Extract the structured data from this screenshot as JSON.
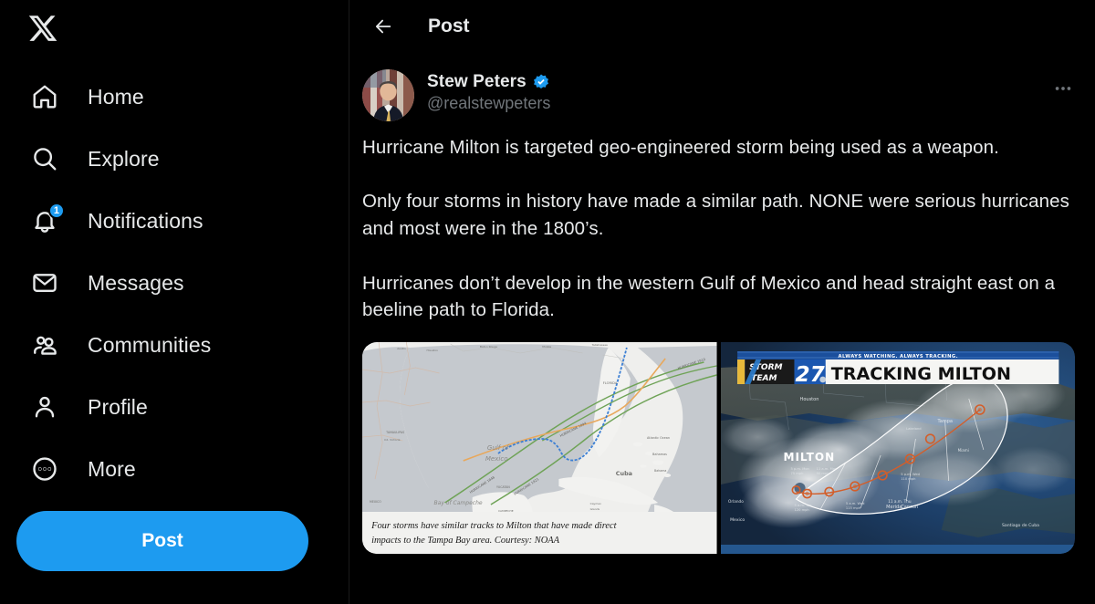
{
  "app": {
    "name": "X",
    "logo_icon": "x-logo-icon"
  },
  "sidebar": {
    "items": [
      {
        "label": "Home",
        "icon": "home-icon",
        "badge": null
      },
      {
        "label": "Explore",
        "icon": "search-icon",
        "badge": null
      },
      {
        "label": "Notifications",
        "icon": "bell-icon",
        "badge": "1"
      },
      {
        "label": "Messages",
        "icon": "envelope-icon",
        "badge": null
      },
      {
        "label": "Communities",
        "icon": "people-icon",
        "badge": null
      },
      {
        "label": "Profile",
        "icon": "person-icon",
        "badge": null
      },
      {
        "label": "More",
        "icon": "more-circle-icon",
        "badge": null
      }
    ],
    "post_button": {
      "label": "Post",
      "color": "#1d9bf0"
    }
  },
  "header": {
    "title": "Post",
    "back_icon": "back-arrow-icon"
  },
  "post": {
    "author": {
      "display_name": "Stew Peters",
      "handle": "@realstewpeters",
      "verified": true,
      "verified_color": "#1d9bf0",
      "avatar_alt": "man-in-suit-with-american-flag"
    },
    "more_icon": "more-options-icon",
    "text": "Hurricane Milton is targeted geo-engineered storm being used as a weapon.\n\nOnly four storms in history have made a similar path. NONE were serious hurricanes and most were in the 1800’s.\n\nHurricanes don’t develop in the western Gulf of Mexico and head straight east on a beeline path to Florida.",
    "media": [
      {
        "type": "map-screenshot",
        "alt": "NOAA map of the Gulf of Mexico showing four historical hurricane tracks toward Tampa Bay",
        "labels": {
          "gulf": "Gulf of Mexico",
          "bay_of_campeche": "Bay of Campeche",
          "cuba": "Cuba",
          "florida": "FLORIDA",
          "bahamas": "Bahamas",
          "tamaulipas": "TAMAULIPAS",
          "yucatan": "YUCATAN",
          "campeche": "CAMPECHE",
          "cayman": "Cayman Islands",
          "mexico": "MEXICO"
        },
        "track_colors": {
          "blue": "#3b7fd4",
          "orange": "#e8a85c",
          "green": "#6fa357"
        },
        "caption": "Four storms have similar tracks to Milton that have made direct impacts to the Tampa Bay area. Courtesy: NOAA"
      },
      {
        "type": "satellite-broadcast-graphic",
        "alt": "Satellite imagery of Hurricane Milton with forecast cone",
        "banner_tagline": "ALWAYS WATCHING. ALWAYS TRACKING.",
        "station_brand_line1": "STORM",
        "station_brand_line2": "TEAM",
        "station_number": "27",
        "headline": "TRACKING MILTON",
        "storm_label": "MILTON",
        "city_labels": [
          "Houston",
          "Tampa",
          "Cancun",
          "Merida",
          "Santiago de Cuba",
          "Mexico"
        ],
        "brand_colors": {
          "blue": "#1b4f9c",
          "gold": "#e8b93a",
          "white": "#ffffff"
        }
      }
    ]
  }
}
